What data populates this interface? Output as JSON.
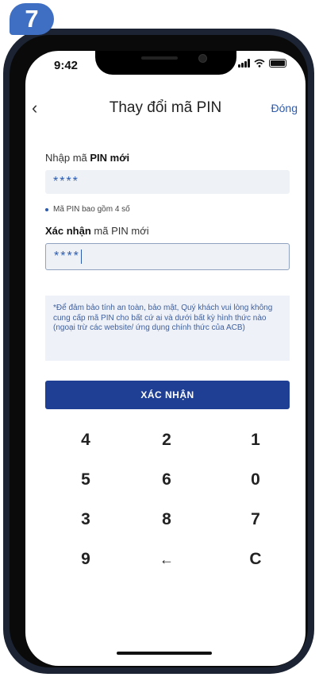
{
  "step": {
    "number": "7"
  },
  "status": {
    "time": "9:42"
  },
  "nav": {
    "back": "‹",
    "title": "Thay đổi mã PIN",
    "close": "Đóng"
  },
  "form": {
    "new_pin_label_prefix": "Nhập mã",
    "new_pin_label_bold": "PIN mới",
    "new_pin_value": "****",
    "hint": "Mã PIN bao gồm 4 số",
    "confirm_label_bold": "Xác nhận",
    "confirm_label_rest": "mã PIN mới",
    "confirm_value": "****"
  },
  "notice": "*Để đảm bảo tính an toàn, bảo mật, Quý khách vui lòng không cung cấp mã PIN cho bất cứ ai và dưới bất kỳ hình thức nào (ngoại trừ các website/ ứng dụng chính thức của ACB)",
  "confirm_button": "XÁC NHẬN",
  "keypad": {
    "row1": [
      "4",
      "2",
      "1"
    ],
    "row2": [
      "5",
      "6",
      "0"
    ],
    "row3": [
      "3",
      "8",
      "7"
    ],
    "row4": [
      "9",
      "←",
      "C"
    ]
  },
  "colors": {
    "accent": "#1e3f94",
    "badge": "#3f6fc3",
    "link": "#2c5bb0"
  }
}
